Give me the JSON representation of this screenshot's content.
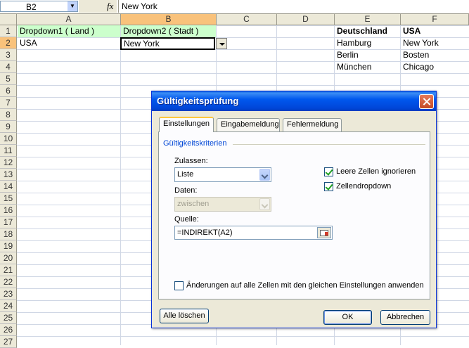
{
  "formula_bar": {
    "name_box": "B2",
    "fx_label": "fx",
    "content": "New York"
  },
  "columns": [
    "A",
    "B",
    "C",
    "D",
    "E",
    "F"
  ],
  "rows": [
    "1",
    "2",
    "3",
    "4",
    "5",
    "6",
    "7",
    "8",
    "9",
    "10",
    "11",
    "12",
    "13",
    "14",
    "15",
    "16",
    "17",
    "18",
    "19",
    "20",
    "21",
    "22",
    "23",
    "24",
    "25",
    "26",
    "27"
  ],
  "cells": {
    "A1": "Dropdown1 ( Land )",
    "B1": "Dropdown2 ( Stadt )",
    "A2": "USA",
    "B2": "New York",
    "E1": "Deutschland",
    "F1": "USA",
    "E2": "Hamburg",
    "F2": "New York",
    "E3": "Berlin",
    "F3": "Bosten",
    "E4": "München",
    "F4": "Chicago"
  },
  "colors": {
    "header_selected": "#f9c27b",
    "label_fill": "#ccffcc",
    "title_bar": "#0058ee"
  },
  "dialog": {
    "title": "Gültigkeitsprüfung",
    "tabs": [
      "Einstellungen",
      "Eingabemeldung",
      "Fehlermeldung"
    ],
    "group_label": "Gültigkeitskriterien",
    "allow_label": "Zulassen:",
    "allow_value": "Liste",
    "data_label": "Daten:",
    "data_value": "zwischen",
    "source_label": "Quelle:",
    "source_value": "=INDIREKT(A2)",
    "ignore_blank_label": "Leere Zellen ignorieren",
    "ignore_blank_checked": true,
    "in_cell_dropdown_label": "Zellendropdown",
    "in_cell_dropdown_checked": true,
    "apply_all_label": "Änderungen auf alle Zellen mit den gleichen Einstellungen anwenden",
    "apply_all_checked": false,
    "clear_all_button": "Alle löschen",
    "ok_button": "OK",
    "cancel_button": "Abbrechen"
  }
}
